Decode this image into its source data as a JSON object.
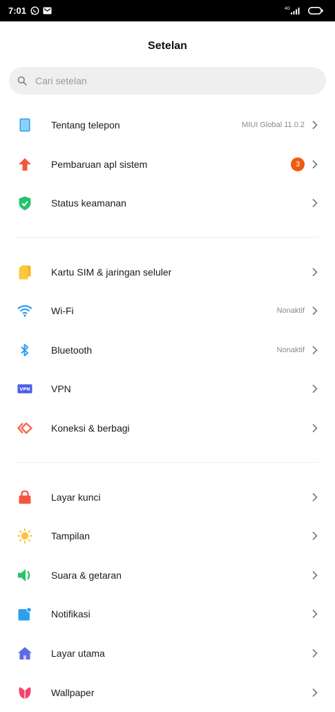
{
  "status_bar": {
    "time": "7:01",
    "network": "4G"
  },
  "page": {
    "title": "Setelan"
  },
  "search": {
    "placeholder": "Cari setelan"
  },
  "colors": {
    "badge": "#f15a0e",
    "accent_blue": "#2aa0ef"
  },
  "items": [
    {
      "label": "Tentang telepon",
      "value": "MIUI Global 11.0.2",
      "icon": "phone-icon"
    },
    {
      "label": "Pembaruan apl sistem",
      "badge": "3",
      "icon": "update-arrow-icon"
    },
    {
      "label": "Status keamanan",
      "icon": "shield-check-icon"
    },
    {
      "label": "Kartu SIM & jaringan seluler",
      "icon": "sim-card-icon"
    },
    {
      "label": "Wi-Fi",
      "value": "Nonaktif",
      "icon": "wifi-icon"
    },
    {
      "label": "Bluetooth",
      "value": "Nonaktif",
      "icon": "bluetooth-icon"
    },
    {
      "label": "VPN",
      "icon": "vpn-icon"
    },
    {
      "label": "Koneksi & berbagi",
      "icon": "connection-sharing-icon"
    },
    {
      "label": "Layar kunci",
      "icon": "lock-icon"
    },
    {
      "label": "Tampilan",
      "icon": "sun-icon"
    },
    {
      "label": "Suara & getaran",
      "icon": "speaker-icon"
    },
    {
      "label": "Notifikasi",
      "icon": "notification-icon"
    },
    {
      "label": "Layar utama",
      "icon": "home-icon"
    },
    {
      "label": "Wallpaper",
      "icon": "wallpaper-flower-icon"
    }
  ]
}
